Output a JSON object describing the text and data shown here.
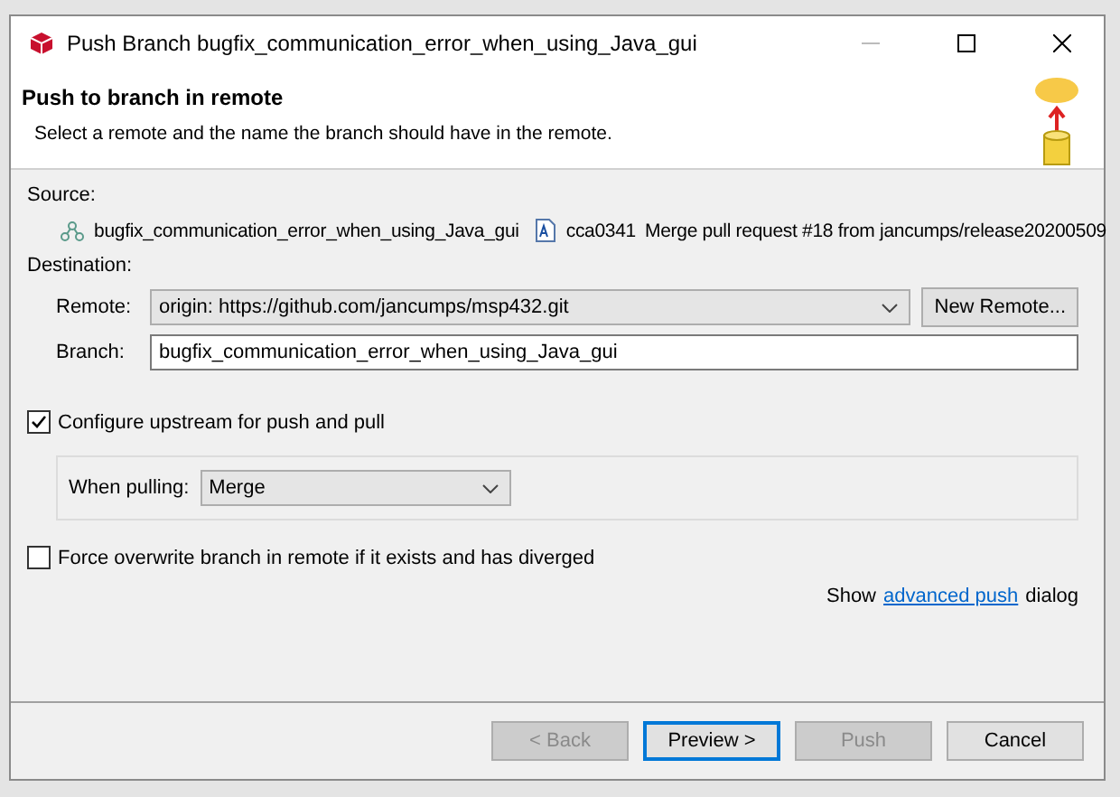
{
  "window": {
    "title": "Push Branch bugfix_communication_error_when_using_Java_gui"
  },
  "header": {
    "title": "Push to branch in remote",
    "description": "Select a remote and the name the branch should have in the remote."
  },
  "source": {
    "label": "Source:",
    "branch": "bugfix_communication_error_when_using_Java_gui",
    "commit_id": "cca0341",
    "commit_message": "Merge pull request #18 from jancumps/release20200509"
  },
  "destination": {
    "label": "Destination:",
    "remote_label": "Remote:",
    "remote_value": "origin: https://github.com/jancumps/msp432.git",
    "new_remote": "New Remote...",
    "branch_label": "Branch:",
    "branch_value": "bugfix_communication_error_when_using_Java_gui"
  },
  "configure_upstream": {
    "label": "Configure upstream for push and pull",
    "checked": true
  },
  "when_pulling": {
    "label": "When pulling:",
    "value": "Merge"
  },
  "force_overwrite": {
    "label": "Force overwrite branch in remote if it exists and has diverged",
    "checked": false
  },
  "advanced": {
    "prefix": "Show",
    "link": "advanced push",
    "suffix": "dialog"
  },
  "buttons": [
    {
      "label": "< Back",
      "disabled": true,
      "default": false
    },
    {
      "label": "Preview >",
      "disabled": false,
      "default": true
    },
    {
      "label": "Push",
      "disabled": true,
      "default": false
    },
    {
      "label": "Cancel",
      "disabled": false,
      "default": false
    }
  ]
}
